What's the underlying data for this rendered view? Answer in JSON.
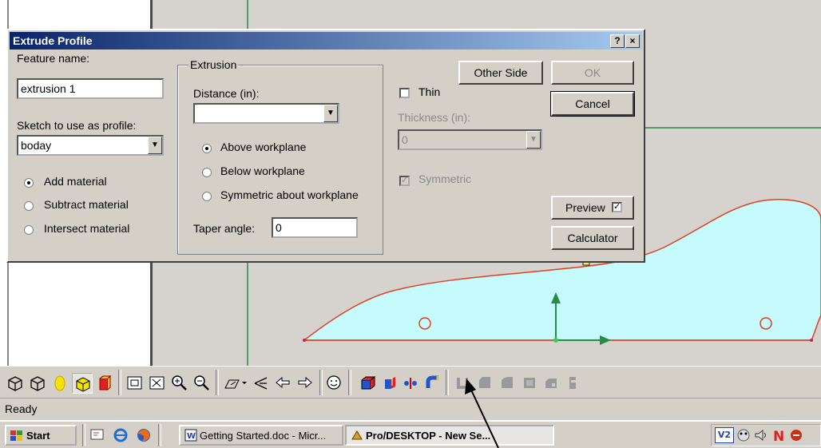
{
  "dialog": {
    "title": "Extrude Profile",
    "help_btn": "?",
    "close_btn": "×",
    "feature_name_label": "Feature name:",
    "feature_name_value": "extrusion 1",
    "sketch_label": "Sketch to use as profile:",
    "sketch_value": "boday",
    "material_options": [
      "Add material",
      "Subtract material",
      "Intersect material"
    ],
    "material_selected": 0,
    "extrusion_group": "Extrusion",
    "distance_label": "Distance (in):",
    "distance_value": "",
    "direction_options": [
      "Above workplane",
      "Below workplane",
      "Symmetric about workplane"
    ],
    "direction_selected": 0,
    "taper_label": "Taper angle:",
    "taper_value": "0",
    "other_side": "Other Side",
    "thin_label": "Thin",
    "thin_checked": false,
    "thickness_label": "Thickness (in):",
    "thickness_value": "0",
    "symmetric_label": "Symmetric",
    "symmetric_checked": true,
    "ok": "OK",
    "cancel": "Cancel",
    "preview": "Preview",
    "preview_checked": true,
    "calculator": "Calculator"
  },
  "status_bar": {
    "text": "Ready"
  },
  "taskbar": {
    "start": "Start",
    "tasks": [
      "Getting Started.doc - Micr...",
      "Pro/DESKTOP - New Se..."
    ],
    "tray_icons": [
      "v2-icon",
      "mascot-icon",
      "speaker-icon",
      "n-icon",
      "app-icon"
    ]
  },
  "colors": {
    "title_start": "#0a246a",
    "profile_fill": "#c6fbfd",
    "profile_line": "#e04020",
    "axis_green": "#2a8a4a"
  }
}
